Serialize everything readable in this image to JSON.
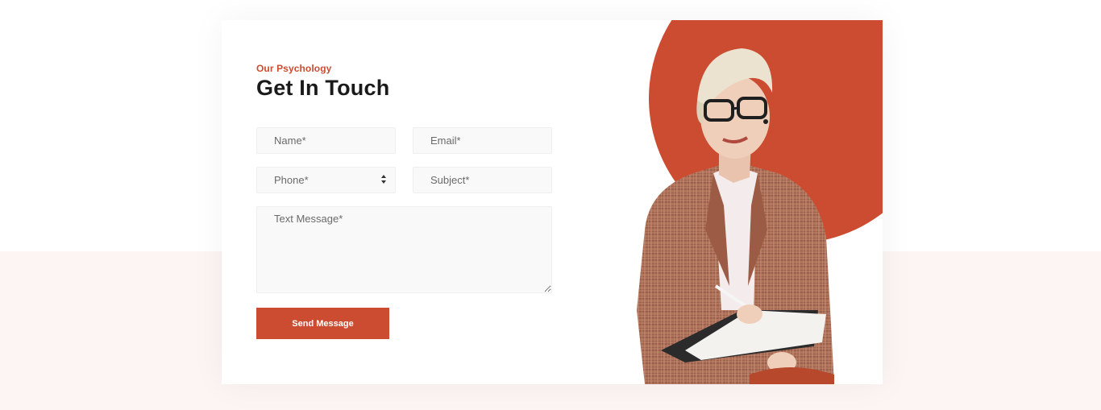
{
  "contact": {
    "subtitle": "Our Psychology",
    "title": "Get In Touch",
    "fields": {
      "name_placeholder": "Name*",
      "email_placeholder": "Email*",
      "phone_placeholder": "Phone*",
      "subject_placeholder": "Subject*",
      "message_placeholder": "Text Message*"
    },
    "send_label": "Send Message"
  },
  "colors": {
    "accent": "#cc4c31",
    "heading": "#1a1a1a",
    "field_bg": "#f9f9f9",
    "page_bottom_bg": "#fdf5f3"
  },
  "image": {
    "alt": "Psychologist portrait"
  }
}
